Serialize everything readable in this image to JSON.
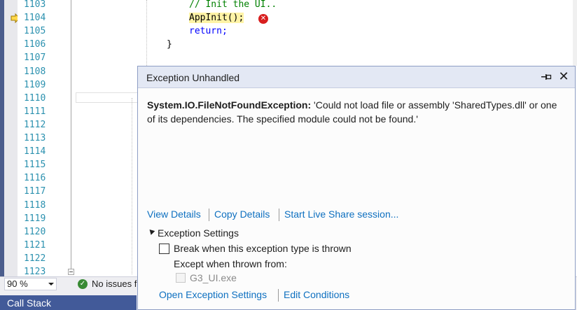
{
  "editor": {
    "line_numbers": [
      "1103",
      "1104",
      "1105",
      "1106",
      "1107",
      "1108",
      "1109",
      "1110",
      "1111",
      "1112",
      "1113",
      "1114",
      "1115",
      "1116",
      "1117",
      "1118",
      "1119",
      "1120",
      "1121",
      "1122",
      "1123"
    ],
    "code": {
      "comment_line": "// Init the UI..",
      "call_line": "AppInit();",
      "return_line": "return;",
      "brace_line": "}"
    }
  },
  "statusbar": {
    "zoom": "90 %",
    "issues": "No issues f"
  },
  "bottom_panel": {
    "tab": "Call Stack"
  },
  "exception": {
    "title": "Exception Unhandled",
    "exception_type": "System.IO.FileNotFoundException:",
    "message": " 'Could not load file or assembly 'SharedTypes.dll' or one of its dependencies. The specified module could not be found.'",
    "links": {
      "view_details": "View Details",
      "copy_details": "Copy Details",
      "live_share": "Start Live Share session..."
    },
    "settings": {
      "header": "Exception Settings",
      "break_label": "Break when this exception type is thrown",
      "except_label": "Except when thrown from:",
      "module_label": "G3_UI.exe",
      "open_settings": "Open Exception Settings",
      "edit_conditions": "Edit Conditions"
    }
  },
  "colors": {
    "accent": "#425a99",
    "link": "#0e70c0",
    "error": "#d81e1e",
    "comment": "#008000",
    "keyword": "#0000ff",
    "line_number": "#2b91af",
    "highlight": "#fff3a6"
  },
  "icons": [
    "execution-arrow-icon",
    "error-icon",
    "check-icon",
    "pin-icon",
    "close-icon",
    "expand-triangle-icon"
  ]
}
